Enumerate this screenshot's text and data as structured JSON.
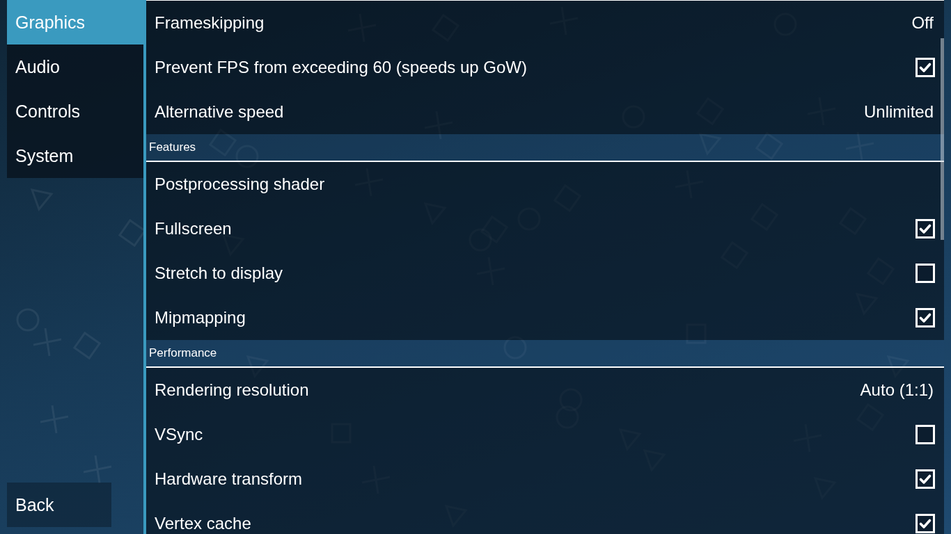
{
  "sidebar": {
    "tabs": [
      {
        "label": "Graphics",
        "selected": true
      },
      {
        "label": "Audio",
        "selected": false
      },
      {
        "label": "Controls",
        "selected": false
      },
      {
        "label": "System",
        "selected": false
      }
    ],
    "back_button": "Back"
  },
  "settings": [
    {
      "kind": "choice",
      "label": "Frameskipping",
      "value": "Off"
    },
    {
      "kind": "checkbox",
      "label": "Prevent FPS from exceeding 60 (speeds up GoW)",
      "checked": true
    },
    {
      "kind": "choice",
      "label": "Alternative speed",
      "value": "Unlimited"
    },
    {
      "kind": "header",
      "label": "Features"
    },
    {
      "kind": "plain",
      "label": "Postprocessing shader"
    },
    {
      "kind": "checkbox",
      "label": "Fullscreen",
      "checked": true
    },
    {
      "kind": "checkbox",
      "label": "Stretch to display",
      "checked": false
    },
    {
      "kind": "checkbox",
      "label": "Mipmapping",
      "checked": true
    },
    {
      "kind": "header",
      "label": "Performance"
    },
    {
      "kind": "choice",
      "label": "Rendering resolution",
      "value": "Auto (1:1)"
    },
    {
      "kind": "checkbox",
      "label": "VSync",
      "checked": false
    },
    {
      "kind": "checkbox",
      "label": "Hardware transform",
      "checked": true
    },
    {
      "kind": "checkbox",
      "label": "Vertex cache",
      "checked": true
    }
  ]
}
